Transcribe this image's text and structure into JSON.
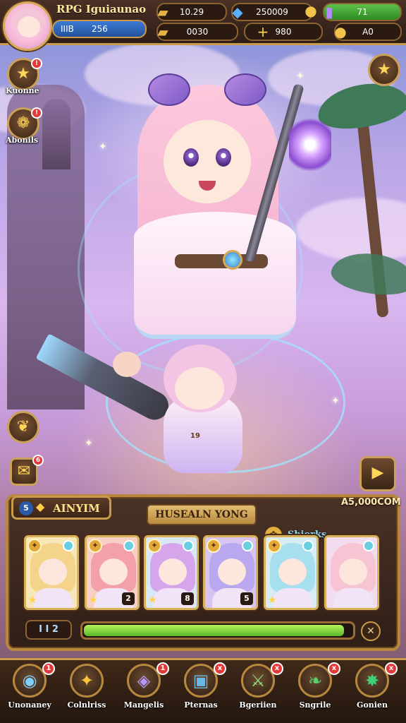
{
  "header": {
    "title": "RPG Iguiaunao",
    "level_label": "IIIB",
    "level_value": "256",
    "resources": [
      {
        "icon": "gold-bar-icon",
        "value": "10.29",
        "plus": ""
      },
      {
        "icon": "blue-gem-icon",
        "value": "250009",
        "plus": ""
      },
      {
        "icon": "gold-coin-icon",
        "value": "",
        "plus": ""
      },
      {
        "icon": "green-stone-icon",
        "value": "71",
        "plus": ""
      },
      {
        "icon": "gold-ingot-icon",
        "value": "0030",
        "plus": "+"
      },
      {
        "icon": "plus-icon",
        "value": "980",
        "plus": ""
      },
      {
        "icon": "coin-icon",
        "value": "A0",
        "plus": ""
      }
    ],
    "accent": "#c99a4a"
  },
  "side_left": [
    {
      "label": "Kuonne",
      "icon": "star-icon",
      "badge": "!"
    },
    {
      "label": "Abonils",
      "icon": "flower-icon",
      "badge": "!"
    }
  ],
  "side_right": {
    "icon": "star-icon"
  },
  "panel": {
    "tab_number": "5",
    "tab_label": "AINYIM",
    "title": "HUSEALN YONG",
    "gold_amount": "A5,000COM",
    "tag_label": "Sbiorks",
    "cards": [
      {
        "top": "✦",
        "num": "",
        "star": "★",
        "hair": "#f4d48a"
      },
      {
        "top": "✦",
        "num": "2",
        "star": "★",
        "hair": "#f4a0a8"
      },
      {
        "top": "✦",
        "num": "8",
        "star": "★",
        "hair": "#d6a6ec"
      },
      {
        "top": "✦",
        "num": "5",
        "star": "",
        "hair": "#b9a8f0"
      },
      {
        "top": "✦",
        "num": "",
        "star": "★",
        "hair": "#a6e0ee"
      },
      {
        "top": "",
        "num": "",
        "star": "",
        "hair": "#f6c4d2"
      }
    ],
    "stat_text": "I I 2",
    "progress": 0.97
  },
  "nav": [
    {
      "label": "Unonaney",
      "icon": "rainbow-orb-icon",
      "badge": "1"
    },
    {
      "label": "Colnlriss",
      "icon": "compass-icon",
      "badge": ""
    },
    {
      "label": "Mangelis",
      "icon": "crystal-card-icon",
      "badge": "1"
    },
    {
      "label": "Pternas",
      "icon": "chest-icon",
      "badge": "x"
    },
    {
      "label": "Bgeriien",
      "icon": "sword-icon",
      "badge": "x"
    },
    {
      "label": "Sngrile",
      "icon": "leaf-icon",
      "badge": "x"
    },
    {
      "label": "Gonien",
      "icon": "emerald-icon",
      "badge": "x"
    }
  ],
  "scene": {
    "mini_label": "19"
  }
}
